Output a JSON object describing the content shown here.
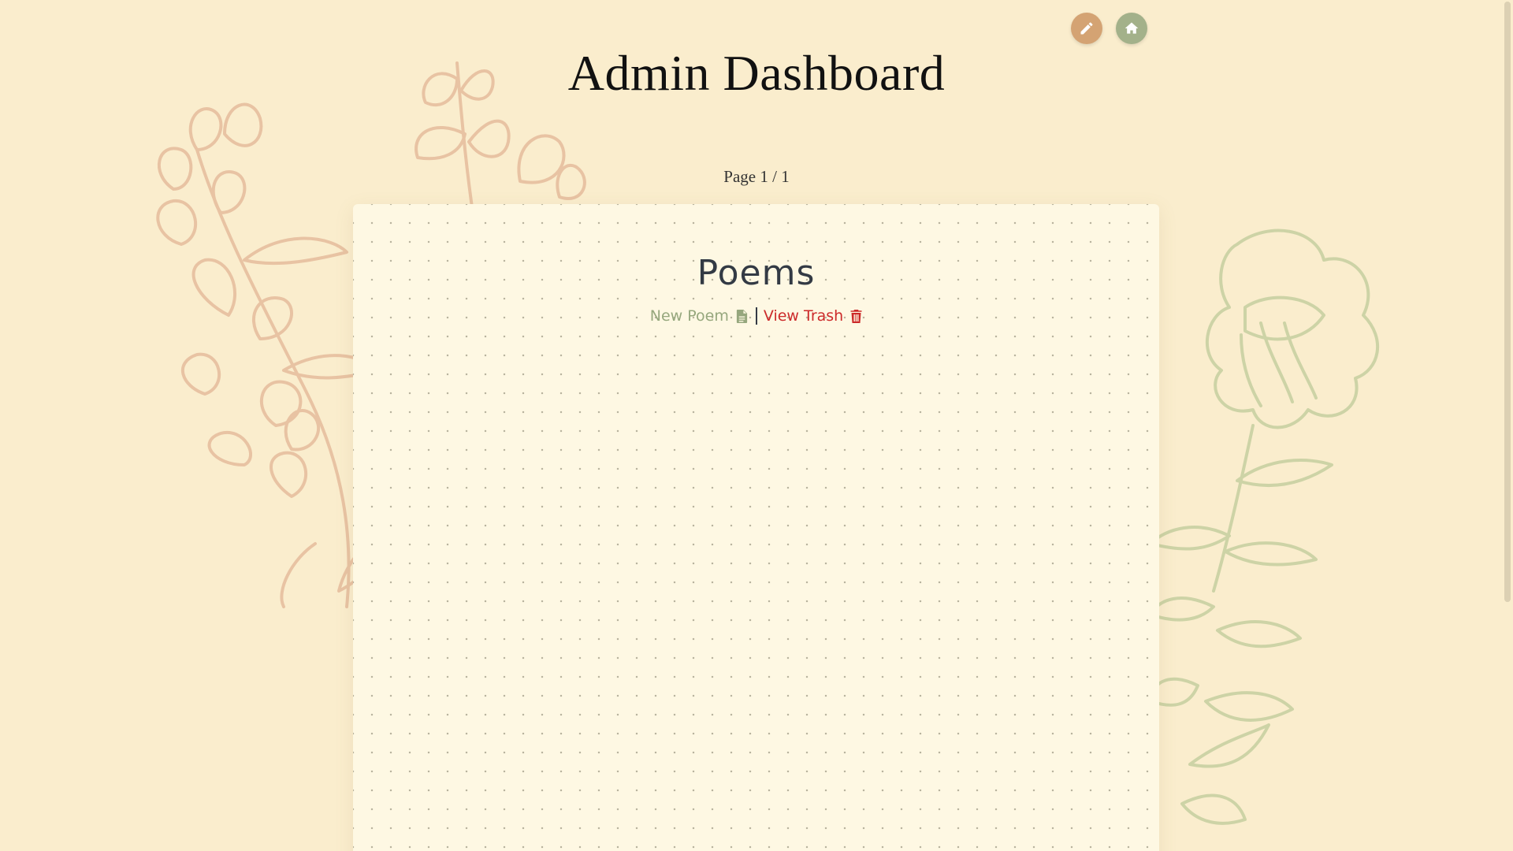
{
  "header": {
    "title": "Admin Dashboard",
    "edit_icon": "pencil-icon",
    "home_icon": "home-icon"
  },
  "pagination": {
    "label": "Page 1 / 1"
  },
  "card": {
    "title": "Poems",
    "actions": {
      "new_poem_label": "New Poem",
      "new_poem_icon": "file-icon",
      "view_trash_label": "View Trash",
      "view_trash_icon": "trash-icon"
    }
  },
  "colors": {
    "background": "#faedcd",
    "card_background": "#fef8e3",
    "edit_button": "#d4a373",
    "home_button": "#a3b18a",
    "new_poem": "#96a77d",
    "view_trash": "#cc2a2a",
    "floral_left": "#e8c3a3",
    "floral_right": "#cdd3a6"
  }
}
